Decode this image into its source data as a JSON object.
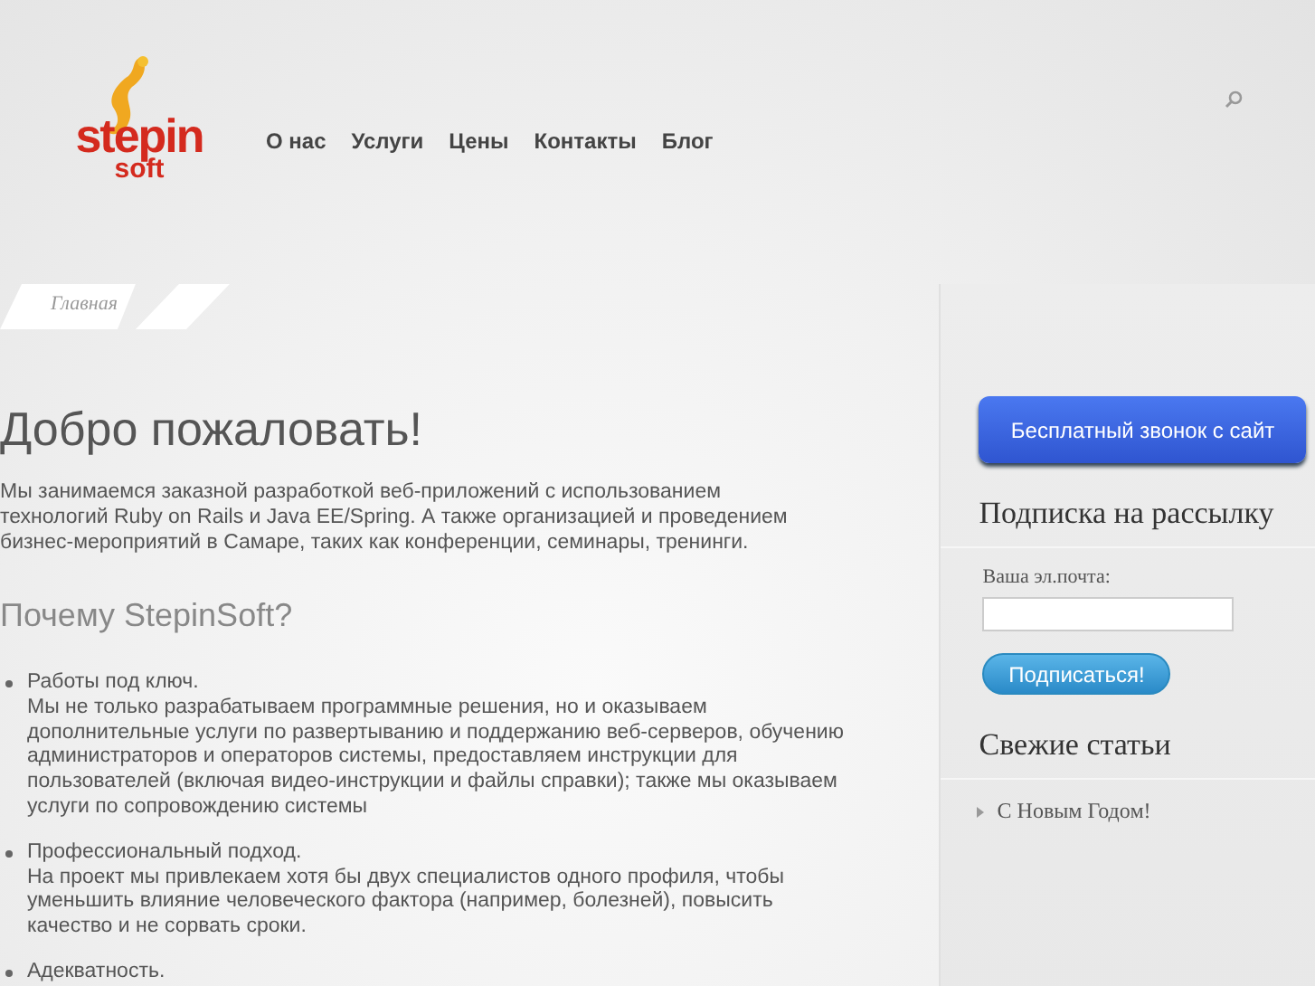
{
  "logo": {
    "line_1": "stepin",
    "line_2": "soft"
  },
  "nav": [
    {
      "label": "О нас"
    },
    {
      "label": "Услуги"
    },
    {
      "label": "Цены"
    },
    {
      "label": "Контакты"
    },
    {
      "label": "Блог"
    }
  ],
  "breadcrumb": "Главная",
  "main": {
    "title": "Добро пожаловать!",
    "intro": "Мы занимаемся заказной разработкой веб-приложений с использованием технологий Ruby on Rails и Java EE/Spring. А также организацией и проведением бизнес-мероприятий в Самаре, таких как конференции, семинары, тренинги.",
    "subtitle": "Почему StepinSoft?",
    "items": [
      {
        "title": "Работы под ключ.",
        "text": "Мы не только разрабатываем программные решения, но и оказываем дополнительные услуги по развертыванию и поддержанию веб-серверов, обучению администраторов и операторов системы, предоставляем инструкции для пользователей (включая видео-инструкции и файлы справки); также мы оказываем услуги по сопровождению системы"
      },
      {
        "title": "Профессиональный подход.",
        "text": "На проект мы привлекаем хотя бы двух специалистов одного профиля, чтобы уменьшить влияние человеческого фактора (например, болезней), повысить качество и не сорвать сроки."
      },
      {
        "title": "Адекватность."
      }
    ]
  },
  "sidebar": {
    "call_button": "Бесплатный звонок с сайт",
    "subscribe_title": "Подписка на рассылку",
    "email_label": "Ваша эл.почта:",
    "subscribe_button": "Подписаться!",
    "recent_title": "Свежие статьи",
    "recent": [
      {
        "label": "С Новым Годом!"
      }
    ]
  }
}
